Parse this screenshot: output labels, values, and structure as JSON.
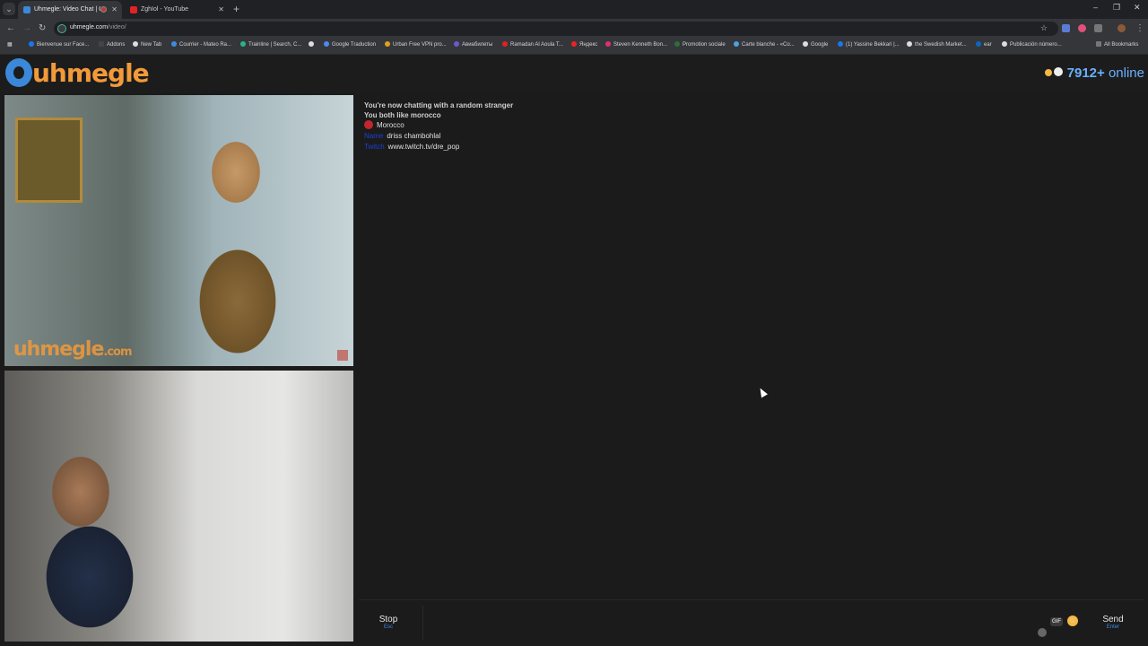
{
  "browser": {
    "tabs": [
      {
        "title": "Uhmegle: Video Chat | Om",
        "favicon_color": "#3b88d8",
        "active": true
      },
      {
        "title": "ZghIol - YouTube",
        "favicon_color": "#e02424",
        "active": false
      }
    ],
    "url_host": "uhmegle.com",
    "url_path": "/video/",
    "bookmarks": [
      {
        "label": "Bienvenue sur Face...",
        "color": "#1877f2"
      },
      {
        "label": "Addons",
        "color": "#444444"
      },
      {
        "label": "New Tab",
        "color": "#dddddd"
      },
      {
        "label": "Courrier - Mateo Ra...",
        "color": "#3c8de0"
      },
      {
        "label": "Trainline | Search, C...",
        "color": "#2bb38b"
      },
      {
        "label": "",
        "color": "#dddddd"
      },
      {
        "label": "Google Traduction",
        "color": "#4a8af4"
      },
      {
        "label": "Urban Free VPN pro...",
        "color": "#e0a020"
      },
      {
        "label": "Авиабилеты",
        "color": "#6a5acd"
      },
      {
        "label": "Ramadan Al Aoula T...",
        "color": "#d22"
      },
      {
        "label": "Яндекс",
        "color": "#e22"
      },
      {
        "label": "Steven Kenneth Bon...",
        "color": "#e1306c"
      },
      {
        "label": "Promotion sociale",
        "color": "#2a6f3a"
      },
      {
        "label": "Carte blanche - «Co...",
        "color": "#4aa3df"
      },
      {
        "label": "Google",
        "color": "#dddddd"
      },
      {
        "label": "(1) Yassine Bekkari |...",
        "color": "#1877f2"
      },
      {
        "label": "the Swedish Market...",
        "color": "#dddddd"
      },
      {
        "label": "ear",
        "color": "#0a66c2"
      },
      {
        "label": "Publicación número...",
        "color": "#dddddd"
      }
    ],
    "all_bookmarks": "All Bookmarks"
  },
  "header": {
    "logo_text": "uhmegle",
    "online_count": "7912+",
    "online_label": "online"
  },
  "videos": {
    "watermark_main": "uhmegle",
    "watermark_suffix": ".com"
  },
  "chat": {
    "system_line_1": "You're now chatting with a random stranger",
    "system_line_2": "You both like morocco",
    "country": "Morocco",
    "name_label": "Name",
    "name_value": "driss chambohlal",
    "link_label": "Twitch",
    "link_value": "www.twitch.tv/dre_pop"
  },
  "chat_bar": {
    "stop_label": "Stop",
    "stop_hint": "Esc",
    "send_label": "Send",
    "send_hint": "Enter",
    "gif_label": "GIF",
    "message_value": ""
  }
}
